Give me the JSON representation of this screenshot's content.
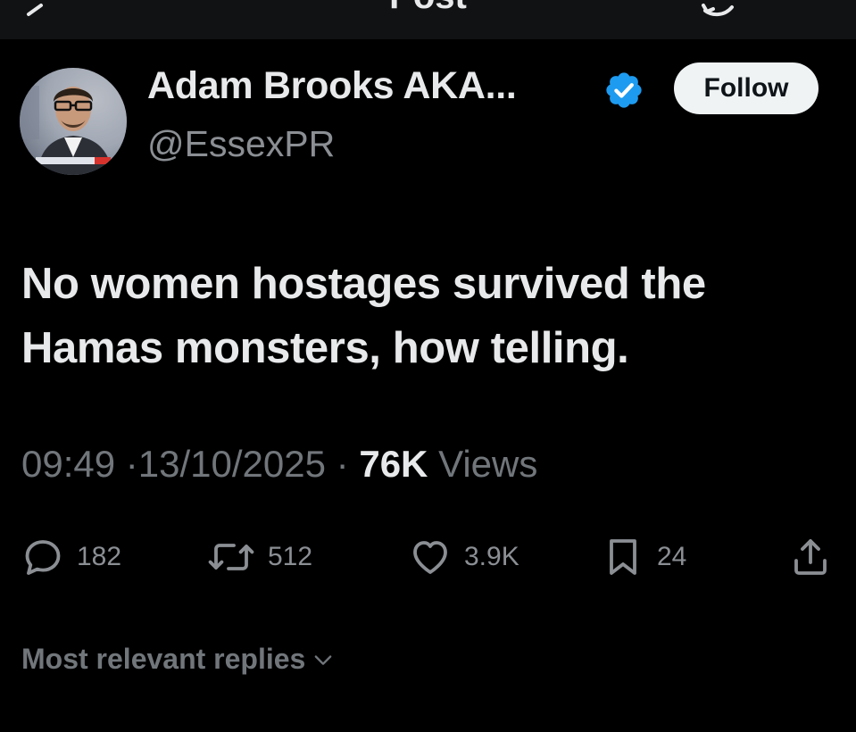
{
  "header": {
    "title": "Post",
    "back_icon": "back-arrow-icon",
    "refresh_icon": "refresh-icon"
  },
  "author": {
    "display_name": "Adam Brooks AKA...",
    "handle": "@EssexPR",
    "verified": true,
    "verified_color": "#1d9bf0",
    "follow_label": "Follow"
  },
  "post": {
    "text": "No women hostages survived the Hamas monsters, how telling."
  },
  "meta": {
    "time": "09:49",
    "separator": "·",
    "date": "13/10/2025",
    "views_count": "76K",
    "views_label": "Views"
  },
  "actions": {
    "replies": "182",
    "reposts": "512",
    "likes": "3.9K",
    "bookmarks": "24",
    "share_icon": "share-icon"
  },
  "replies_filter": {
    "label": "Most relevant replies"
  },
  "colors": {
    "background": "#000000",
    "top_bar": "#111214",
    "primary_text": "#e7e9ea",
    "secondary_text": "#71767b",
    "follow_button_bg": "#eff3f4"
  }
}
